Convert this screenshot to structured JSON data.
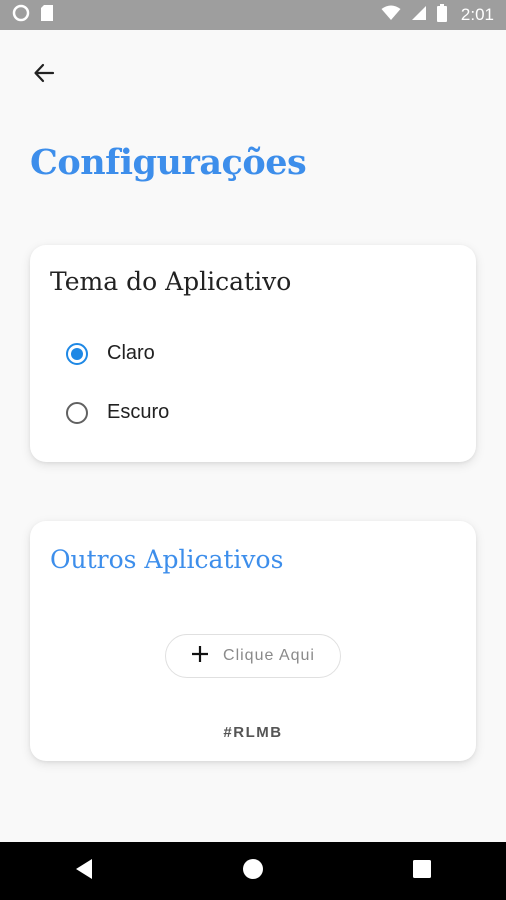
{
  "status_bar": {
    "time": "2:01"
  },
  "page": {
    "title": "Configurações"
  },
  "theme_card": {
    "title": "Tema do Aplicativo",
    "options": [
      {
        "label": "Claro",
        "checked": true
      },
      {
        "label": "Escuro",
        "checked": false
      }
    ]
  },
  "apps_card": {
    "title": "Outros Aplicativos",
    "button_label": "Clique Aqui",
    "hashtag": "#RLMB"
  },
  "icons": [
    "circle-icon",
    "sd-card-icon",
    "wifi-icon",
    "signal-icon",
    "battery-icon",
    "arrow-back-icon",
    "plus-icon",
    "nav-back-icon",
    "nav-home-icon",
    "nav-recents-icon"
  ],
  "colors": {
    "accent": "#3d8eeb",
    "radio": "#1e88e5",
    "status_bar": "#9e9e9e",
    "background": "#f9f9f9"
  }
}
